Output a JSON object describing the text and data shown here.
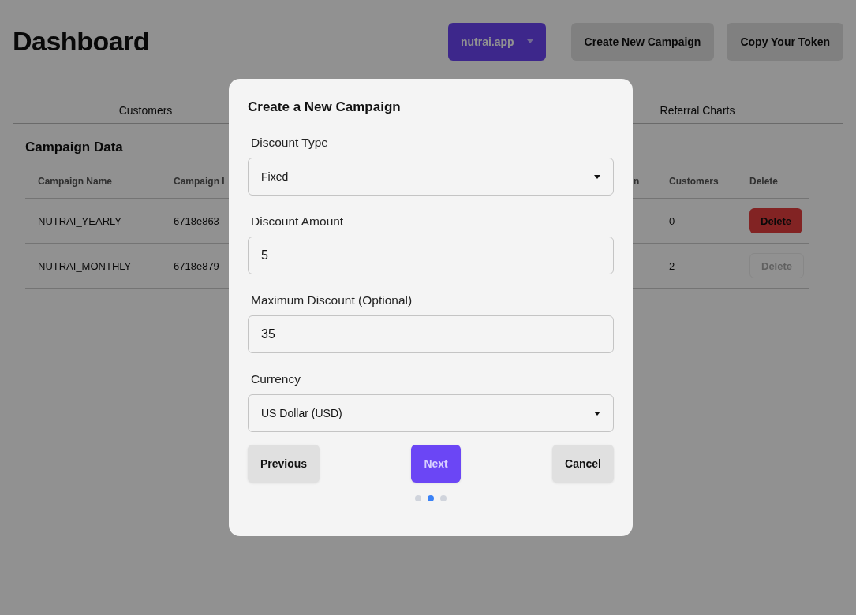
{
  "header": {
    "title": "Dashboard",
    "site_selector": "nutrai.app",
    "buttons": [
      "Create New Campaign",
      "Copy Your Token"
    ]
  },
  "tabs": [
    {
      "label": "Customers"
    },
    {
      "label": "Referral Charts"
    }
  ],
  "campaign_data": {
    "title": "Campaign Data",
    "columns": [
      "Campaign Name",
      "Campaign I",
      "n",
      "Customers",
      "Delete"
    ],
    "rows": [
      {
        "name": "NUTRAI_YEARLY",
        "id": "6718e863",
        "customers": "0",
        "delete": "Delete",
        "disabled": false
      },
      {
        "name": "NUTRAI_MONTHLY",
        "id": "6718e879",
        "customers": "2",
        "delete": "Delete",
        "disabled": true
      }
    ]
  },
  "modal": {
    "title": "Create a New Campaign",
    "fields": [
      {
        "kind": "select",
        "label": "Discount Type",
        "value": "Fixed"
      },
      {
        "kind": "input",
        "label": "Discount Amount",
        "value": "5"
      },
      {
        "kind": "input",
        "label": "Maximum Discount (Optional)",
        "value": "35"
      },
      {
        "kind": "select",
        "label": "Currency",
        "value": "US Dollar (USD)"
      }
    ],
    "buttons": {
      "previous": "Previous",
      "next": "Next",
      "cancel": "Cancel"
    },
    "steps": [
      {
        "selected": false
      },
      {
        "selected": true
      },
      {
        "selected": false
      }
    ]
  }
}
